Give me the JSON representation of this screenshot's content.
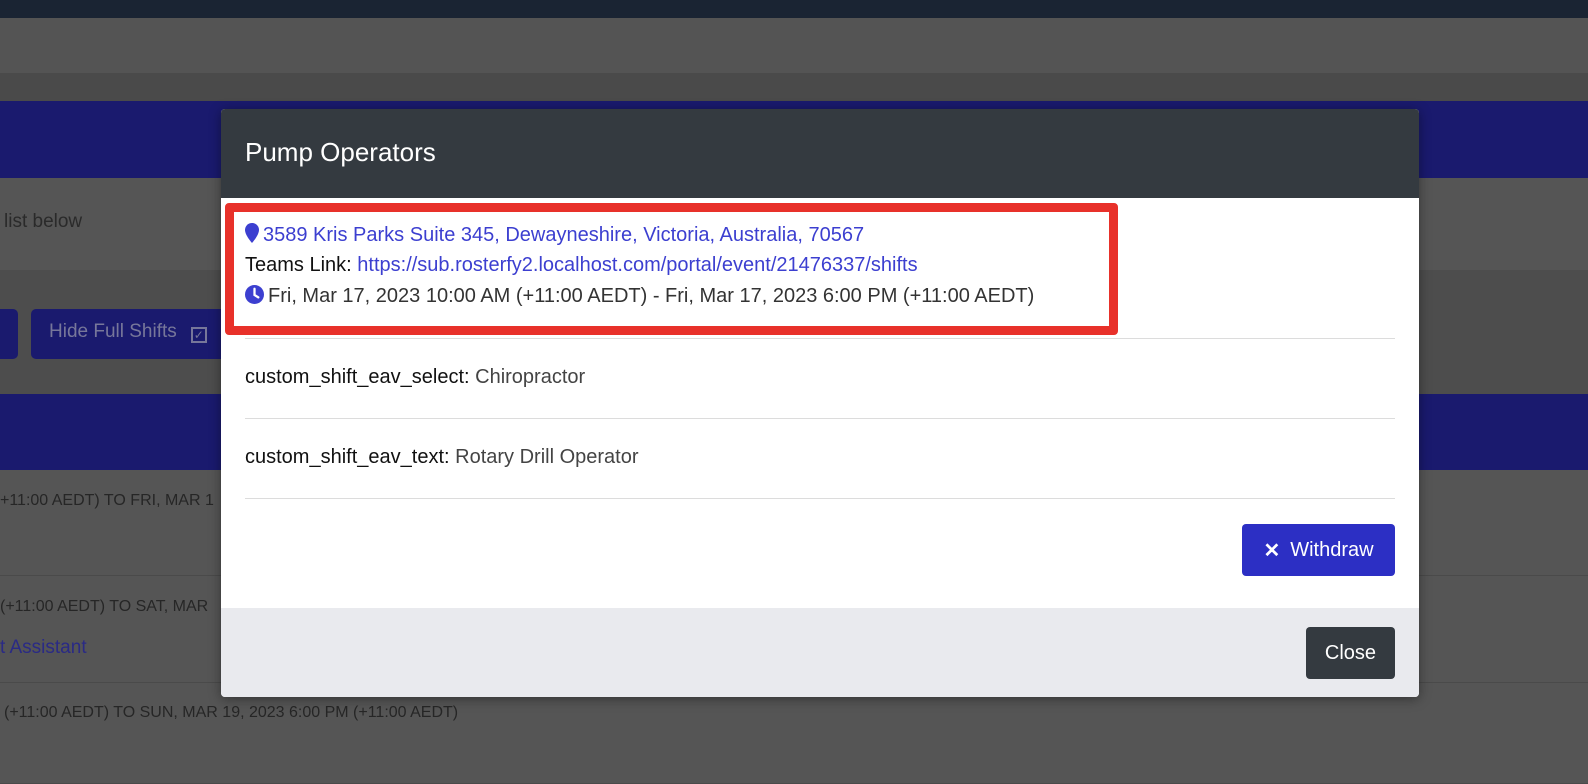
{
  "background": {
    "info_text": "list below",
    "hide_full_shifts_label": "Hide Full Shifts",
    "rows": [
      {
        "text": "+11:00 AEDT) TO FRI, MAR 1"
      },
      {
        "text": "(+11:00 AEDT) TO SAT, MAR",
        "link": "t Assistant"
      },
      {
        "text": "(+11:00 AEDT) TO SUN, MAR 19, 2023 6:00 PM (+11:00 AEDT)"
      }
    ]
  },
  "modal": {
    "title": "Pump Operators",
    "address": "3589 Kris Parks Suite 345, Dewayneshire, Victoria, Australia, 70567",
    "teams_label": "Teams Link:",
    "teams_url": "https://sub.rosterfy2.localhost.com/portal/event/21476337/shifts",
    "time_range": "Fri, Mar 17, 2023 10:00 AM (+11:00 AEDT) - Fri, Mar 17, 2023 6:00 PM (+11:00 AEDT)",
    "fields": [
      {
        "label": "custom_shift_eav_select:",
        "value": "Chiropractor"
      },
      {
        "label": "custom_shift_eav_text:",
        "value": "Rotary Drill Operator"
      }
    ],
    "withdraw_label": "Withdraw",
    "close_label": "Close"
  },
  "colors": {
    "modal_header": "#343a40",
    "link": "#3c3fd0",
    "primary_button": "#2c2fc4",
    "highlight_border": "#e8312a"
  }
}
